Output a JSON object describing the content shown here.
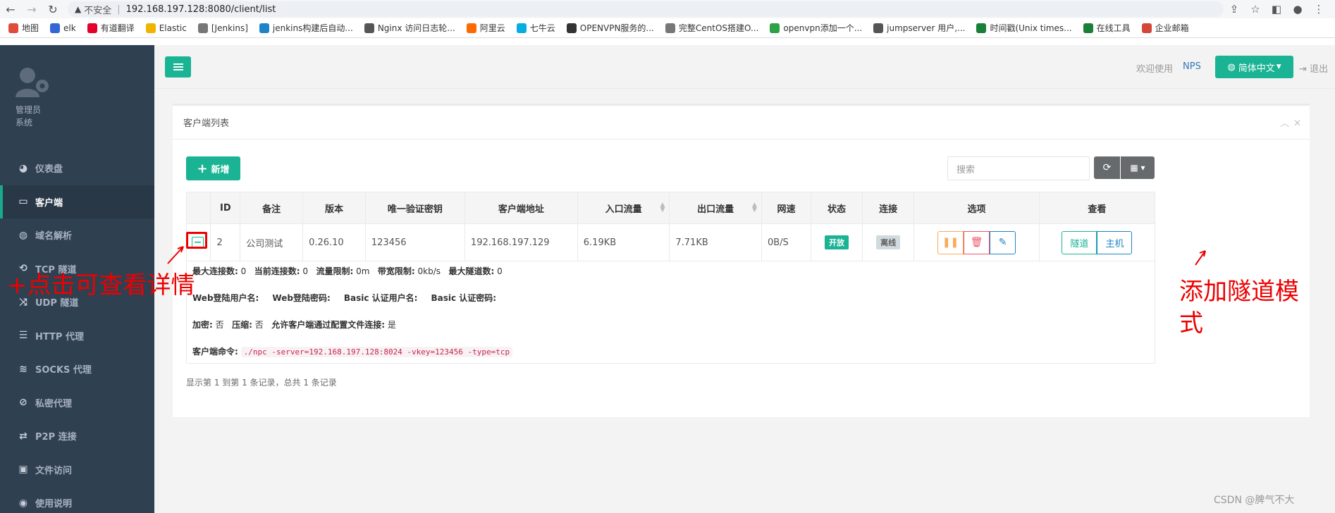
{
  "browser": {
    "security_label": "不安全",
    "url": "192.168.197.128:8080/client/list"
  },
  "bookmarks": [
    {
      "label": "地图",
      "color": "#e04c3a"
    },
    {
      "label": "elk",
      "color": "#3367d6"
    },
    {
      "label": "有道翻译",
      "color": "#e4002b"
    },
    {
      "label": "Elastic",
      "color": "#f0b400"
    },
    {
      "label": "[Jenkins]",
      "color": "#777777"
    },
    {
      "label": "jenkins构建后自动...",
      "color": "#1c84c6"
    },
    {
      "label": "Nginx 访问日志轮...",
      "color": "#555555"
    },
    {
      "label": "阿里云",
      "color": "#ff6a00"
    },
    {
      "label": "七牛云",
      "color": "#06aee0"
    },
    {
      "label": "OPENVPN服务的...",
      "color": "#333333"
    },
    {
      "label": "完整CentOS搭建O...",
      "color": "#777777"
    },
    {
      "label": "openvpn添加一个...",
      "color": "#2ba245"
    },
    {
      "label": "jumpserver 用户,...",
      "color": "#555555"
    },
    {
      "label": "时间戳(Unix times...",
      "color": "#1a7f37"
    },
    {
      "label": "在线工具",
      "color": "#1a7f37"
    },
    {
      "label": "企业邮箱",
      "color": "#d44638"
    }
  ],
  "sidebar": {
    "user_name": "管理员",
    "user_role": "系统",
    "items": [
      {
        "label": "仪表盘",
        "icon": "dashboard-icon",
        "glyph": "◕"
      },
      {
        "label": "客户端",
        "icon": "monitor-icon",
        "glyph": "▭",
        "active": true
      },
      {
        "label": "域名解析",
        "icon": "globe-icon",
        "glyph": "◍"
      },
      {
        "label": "TCP 隧道",
        "icon": "link-icon",
        "glyph": "⟲"
      },
      {
        "label": "UDP 隧道",
        "icon": "shuffle-icon",
        "glyph": "⤨"
      },
      {
        "label": "HTTP 代理",
        "icon": "server-icon",
        "glyph": "☰"
      },
      {
        "label": "SOCKS 代理",
        "icon": "layers-icon",
        "glyph": "≋"
      },
      {
        "label": "私密代理",
        "icon": "eye-slash-icon",
        "glyph": "⊘"
      },
      {
        "label": "P2P 连接",
        "icon": "exchange-icon",
        "glyph": "⇄"
      },
      {
        "label": "文件访问",
        "icon": "briefcase-icon",
        "glyph": "▣"
      },
      {
        "label": "使用说明",
        "icon": "lightbulb-icon",
        "glyph": "◉"
      }
    ]
  },
  "topbar": {
    "welcome": "欢迎使用",
    "brand": "NPS",
    "language": "简体中文",
    "logout": "退出"
  },
  "panel": {
    "title": "客户端列表",
    "add_label": "新增",
    "search_placeholder": "搜索"
  },
  "table": {
    "headers": [
      "",
      "ID",
      "备注",
      "版本",
      "唯一验证密钥",
      "客户端地址",
      "入口流量",
      "出口流量",
      "网速",
      "状态",
      "连接",
      "选项",
      "查看"
    ],
    "rows": [
      {
        "expand": "−",
        "id": "2",
        "remark": "公司测试",
        "version": "0.26.10",
        "vkey": "123456",
        "address": "192.168.197.129",
        "in_flow": "6.19KB",
        "out_flow": "7.71KB",
        "speed": "0B/S",
        "status": "开放",
        "connection": "离线",
        "view_tunnel": "隧道",
        "view_host": "主机"
      }
    ]
  },
  "detail": {
    "max_conn_label": "最大连接数:",
    "max_conn": "0",
    "cur_conn_label": "当前连接数:",
    "cur_conn": "0",
    "flow_limit_label": "流量限制:",
    "flow_limit": "0m",
    "rate_limit_label": "带宽限制:",
    "rate_limit": "0kb/s",
    "max_tunnel_label": "最大隧道数:",
    "max_tunnel": "0",
    "web_user_label": "Web登陆用户名:",
    "web_pass_label": "Web登陆密码:",
    "basic_user_label": "Basic 认证用户名:",
    "basic_pass_label": "Basic 认证密码:",
    "crypt_label": "加密:",
    "crypt": "否",
    "compress_label": "压缩:",
    "compress": "否",
    "config_conn_label": "允许客户端通过配置文件连接:",
    "config_conn": "是",
    "cmd_label": "客户端命令:",
    "cmd": "./npc -server=192.168.197.128:8024 -vkey=123456 -type=tcp"
  },
  "pagination": {
    "info": "显示第 1 到第 1 条记录，总共 1 条记录"
  },
  "annotations": {
    "left": "+点击可查看详情",
    "right": "添加隧道模式"
  },
  "watermark": "CSDN @脾气不大"
}
